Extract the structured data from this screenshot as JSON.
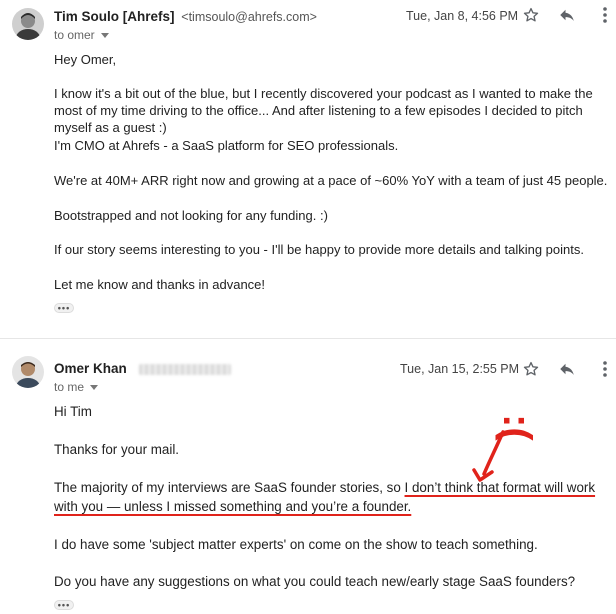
{
  "messages": [
    {
      "sender_name": "Tim Soulo [Ahrefs]",
      "sender_email": "<timsoulo@ahrefs.com>",
      "recipient": "to omer",
      "date": "Tue, Jan 8, 4:56 PM",
      "paragraphs": [
        "Hey Omer,",
        "I know it's a bit out of the blue, but I recently discovered your podcast as I wanted to make the most of my time driving to the office... And after listening to a few episodes I decided to pitch myself as a guest :)",
        "I'm CMO at Ahrefs - a SaaS platform for SEO professionals.",
        "We're at 40M+ ARR right now and growing at a pace of ~60% YoY with a team of just 45 people.",
        "Bootstrapped and not looking for any funding. :)",
        "If our story seems interesting to you - I'll be happy to provide more details and talking points.",
        "Let me know and thanks in advance!"
      ],
      "trim_label": "•••"
    },
    {
      "sender_name": "Omer Khan",
      "recipient": "to me",
      "date": "Tue, Jan 15, 2:55 PM",
      "greeting": "Hi Tim",
      "thanks": "Thanks for your mail.",
      "para_before": "The majority of my interviews are SaaS founder stories, so ",
      "para_highlight": "I don’t think that format will work with you — unless I missed something and you’re a founder.",
      "para_experts": "I do have some 'subject matter experts' on come on the show to teach something.",
      "para_question": "Do you have any suggestions on what you could teach new/early stage SaaS founders?",
      "trim_label": "•••"
    }
  ],
  "annotation": {
    "face": ":(",
    "color": "#e0231b"
  },
  "icons": [
    "star-icon",
    "reply-icon",
    "more-vert-icon",
    "caret-down-icon"
  ]
}
